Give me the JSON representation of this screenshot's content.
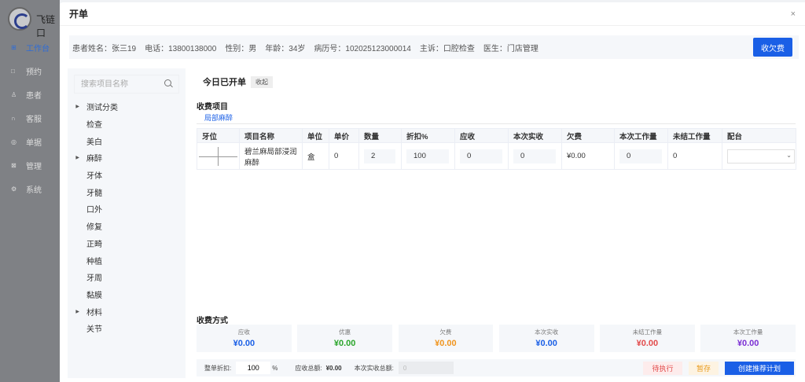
{
  "app": {
    "name": "飞链口"
  },
  "nav": [
    {
      "icon": "dashboard-icon",
      "glyph": "⊞",
      "label": "工作台",
      "active": true
    },
    {
      "icon": "calendar-icon",
      "glyph": "□",
      "label": "预约",
      "active": false
    },
    {
      "icon": "user-icon",
      "glyph": "♙",
      "label": "患者",
      "active": false
    },
    {
      "icon": "headset-icon",
      "glyph": "∩",
      "label": "客服",
      "active": false
    },
    {
      "icon": "document-icon",
      "glyph": "◎",
      "label": "单据",
      "active": false
    },
    {
      "icon": "grid-icon",
      "glyph": "⊠",
      "label": "管理",
      "active": false
    },
    {
      "icon": "gear-icon",
      "glyph": "⚙",
      "label": "系统",
      "active": false
    }
  ],
  "modal": {
    "title": "开单",
    "close": "×"
  },
  "patient": {
    "fields": [
      "患者姓名：张三19",
      "电话：13800138000",
      "性别：男",
      "年龄：34岁",
      "病历号：102025123000014",
      "主诉：口腔检查",
      "医生：门店管理"
    ],
    "button": "收欠费"
  },
  "sidebar": {
    "search_placeholder": "搜索项目名称",
    "items": [
      {
        "label": "测试分类",
        "expandable": true
      },
      {
        "label": "检查",
        "expandable": false
      },
      {
        "label": "美白",
        "expandable": false
      },
      {
        "label": "麻醉",
        "expandable": true
      },
      {
        "label": "牙体",
        "expandable": false
      },
      {
        "label": "牙髓",
        "expandable": false
      },
      {
        "label": "口外",
        "expandable": false
      },
      {
        "label": "修复",
        "expandable": false
      },
      {
        "label": "正畸",
        "expandable": false
      },
      {
        "label": "种植",
        "expandable": false
      },
      {
        "label": "牙周",
        "expandable": false
      },
      {
        "label": "黏膜",
        "expandable": false
      },
      {
        "label": "材料",
        "expandable": true
      },
      {
        "label": "关节",
        "expandable": false
      }
    ]
  },
  "today": {
    "title": "今日已开单",
    "collapse": "收起"
  },
  "charges": {
    "title": "收费项目",
    "tab": "局部麻醉",
    "columns": [
      "牙位",
      "项目名称",
      "单位",
      "单价",
      "数量",
      "折扣%",
      "应收",
      "本次实收",
      "欠费",
      "本次工作量",
      "未结工作量",
      "配台"
    ],
    "rows": [
      {
        "name": "碧兰麻局部浸润麻醉",
        "unit": "盒",
        "price": "0",
        "qty": "2",
        "discount": "100",
        "receivable": "0",
        "paid": "0",
        "owed": "¥0.00",
        "work": "0",
        "pending_work": "0",
        "assistant": ""
      }
    ]
  },
  "payment": {
    "title": "收费方式",
    "cards": [
      {
        "label": "应收",
        "value": "¥0.00",
        "color": "#1a5fe6"
      },
      {
        "label": "优惠",
        "value": "¥0.00",
        "color": "#2aa52a"
      },
      {
        "label": "欠费",
        "value": "¥0.00",
        "color": "#f0951e"
      },
      {
        "label": "本次实收",
        "value": "¥0.00",
        "color": "#1a5fe6"
      },
      {
        "label": "未结工作量",
        "value": "¥0.00",
        "color": "#e24b4b"
      },
      {
        "label": "本次工作量",
        "value": "¥0.00",
        "color": "#7b2fd4"
      }
    ]
  },
  "footer": {
    "discount_label": "整单折扣:",
    "discount_value": "100",
    "percent": "%",
    "total_label": "应收总额:",
    "total_value": "¥0.00",
    "actual_label": "本次实收总额:",
    "actual_value": "0",
    "btn_pending": "待执行",
    "btn_save": "暂存",
    "btn_create": "创建推荐计划"
  }
}
